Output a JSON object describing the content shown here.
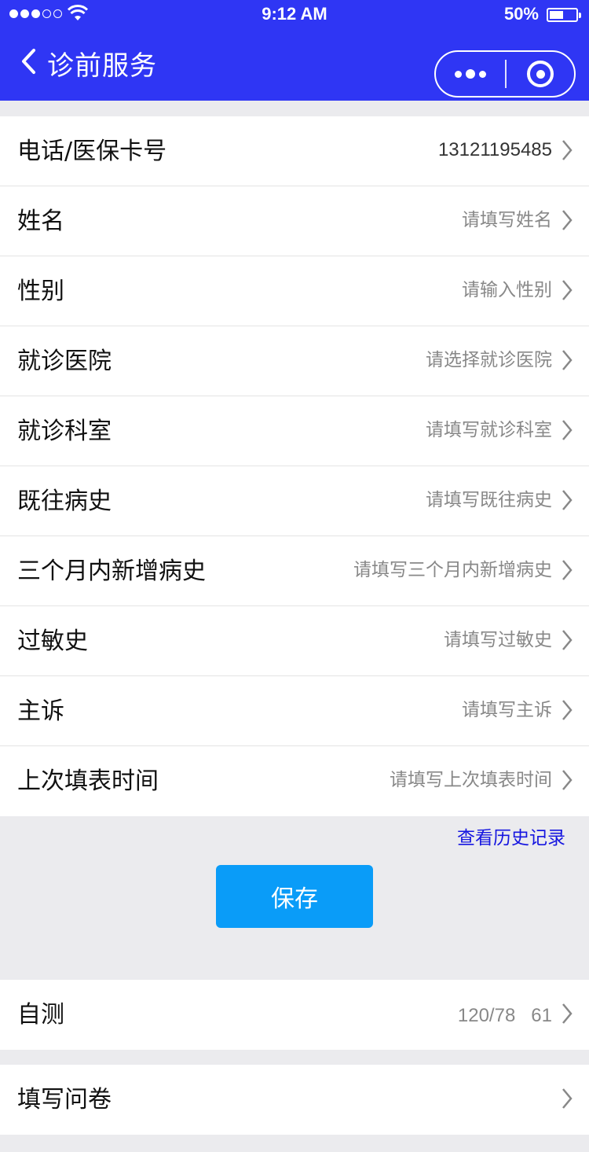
{
  "status_bar": {
    "time": "9:12 AM",
    "battery": "50%",
    "battery_level": 0.5,
    "signal_bars_filled": 3,
    "signal_bars_total": 5
  },
  "nav": {
    "title": "诊前服务",
    "icons": {
      "back": "chevron-left-icon",
      "more": "more-dots-icon",
      "close": "close-target-icon"
    },
    "color": "#2f36f4"
  },
  "form": [
    {
      "label": "电话/医保卡号",
      "value": "13121195485",
      "filled": true
    },
    {
      "label": "姓名",
      "value": "请填写姓名",
      "filled": false
    },
    {
      "label": "性别",
      "value": "请输入性别",
      "filled": false
    },
    {
      "label": "就诊医院",
      "value": "请选择就诊医院",
      "filled": false
    },
    {
      "label": "就诊科室",
      "value": "请填写就诊科室",
      "filled": false
    },
    {
      "label": "既往病史",
      "value": "请填写既往病史",
      "filled": false
    },
    {
      "label": "三个月内新增病史",
      "value": "请填写三个月内新增病史",
      "filled": false
    },
    {
      "label": "过敏史",
      "value": "请填写过敏史",
      "filled": false
    },
    {
      "label": "主诉",
      "value": "请填写主诉",
      "filled": false
    },
    {
      "label": "上次填表时间",
      "value": "请填写上次填表时间",
      "filled": false
    }
  ],
  "history_link": "查看历史记录",
  "save_button": "保存",
  "self_test": {
    "label": "自测",
    "value": "120/78   61"
  },
  "survey": {
    "label": "填写问卷"
  },
  "colors": {
    "accent": "#0a9cf8",
    "link": "#1616e0",
    "background": "#ebebee"
  }
}
